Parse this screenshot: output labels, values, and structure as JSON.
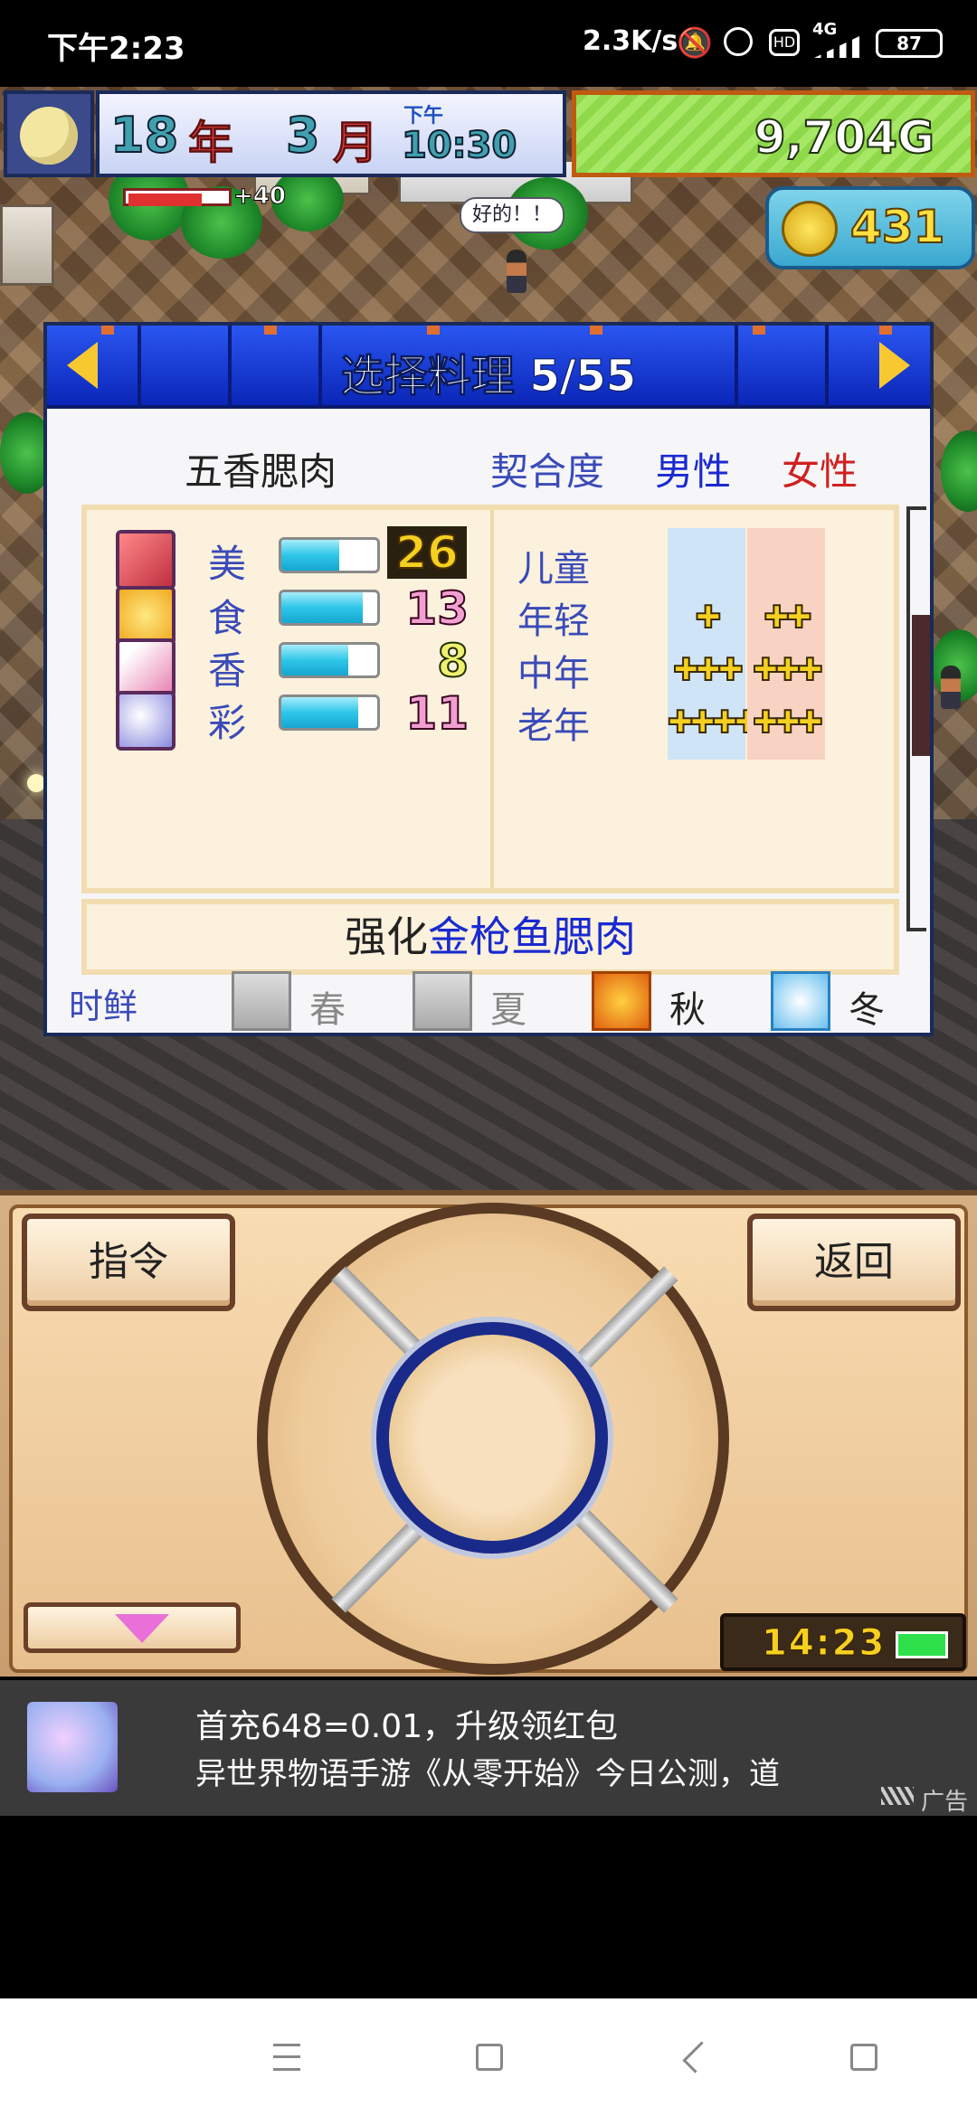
{
  "status_bar": {
    "time": "下午2:23",
    "net_speed": "2.3K/s",
    "network": "4G",
    "battery": "87"
  },
  "hud": {
    "year_num": "18",
    "year_label": "年",
    "month_num": "3",
    "month_label": "月",
    "ampm": "下午",
    "clock": "10:30",
    "money": "9,704G",
    "coins": "431",
    "mood_delta": "+40",
    "mood_level": 0.75,
    "speech": "好的！！"
  },
  "dialog": {
    "title": "选择料理 5/55",
    "dish_name": "五香腮肉",
    "affinity_label": "契合度",
    "male_label": "男性",
    "female_label": "女性",
    "stats": [
      {
        "label": "美",
        "value": "26",
        "level": 0.6,
        "icon": "beauty-icon",
        "style": "gold"
      },
      {
        "label": "食",
        "value": "13",
        "level": 0.85,
        "icon": "taste-icon",
        "style": "pink"
      },
      {
        "label": "香",
        "value": "8",
        "level": 0.7,
        "icon": "aroma-icon",
        "style": "yel"
      },
      {
        "label": "彩",
        "value": "11",
        "level": 0.8,
        "icon": "color-icon",
        "style": "pink"
      }
    ],
    "ages": [
      {
        "label": "儿童",
        "male": "",
        "female": ""
      },
      {
        "label": "年轻",
        "male": "✚",
        "female": "✚✚"
      },
      {
        "label": "中年",
        "male": "✚✚✚",
        "female": "✚✚✚"
      },
      {
        "label": "老年",
        "male": "✚✚✚✚",
        "female": "✚✚✚"
      }
    ],
    "strengthen_prefix": "强化",
    "strengthen_target": "金枪鱼腮肉",
    "season_label": "时鲜",
    "seasons": [
      {
        "label": "春",
        "active": false
      },
      {
        "label": "夏",
        "active": false
      },
      {
        "label": "秋",
        "active": true
      },
      {
        "label": "冬",
        "active": true
      }
    ]
  },
  "controller": {
    "command_label": "指令",
    "back_label": "返回",
    "clock": "14:23"
  },
  "ad": {
    "line1": "首充648=0.01，升级领红包",
    "line2": "异世界物语手游《从零开始》今日公测，道",
    "tag": "广告"
  },
  "colors": {
    "dialog_header": "#0a26b8",
    "panel_bg": "#fbf1dc",
    "male_cell": "#cfe4f6",
    "female_cell": "#f8d2c2",
    "money_bg": "#8ed84a"
  }
}
